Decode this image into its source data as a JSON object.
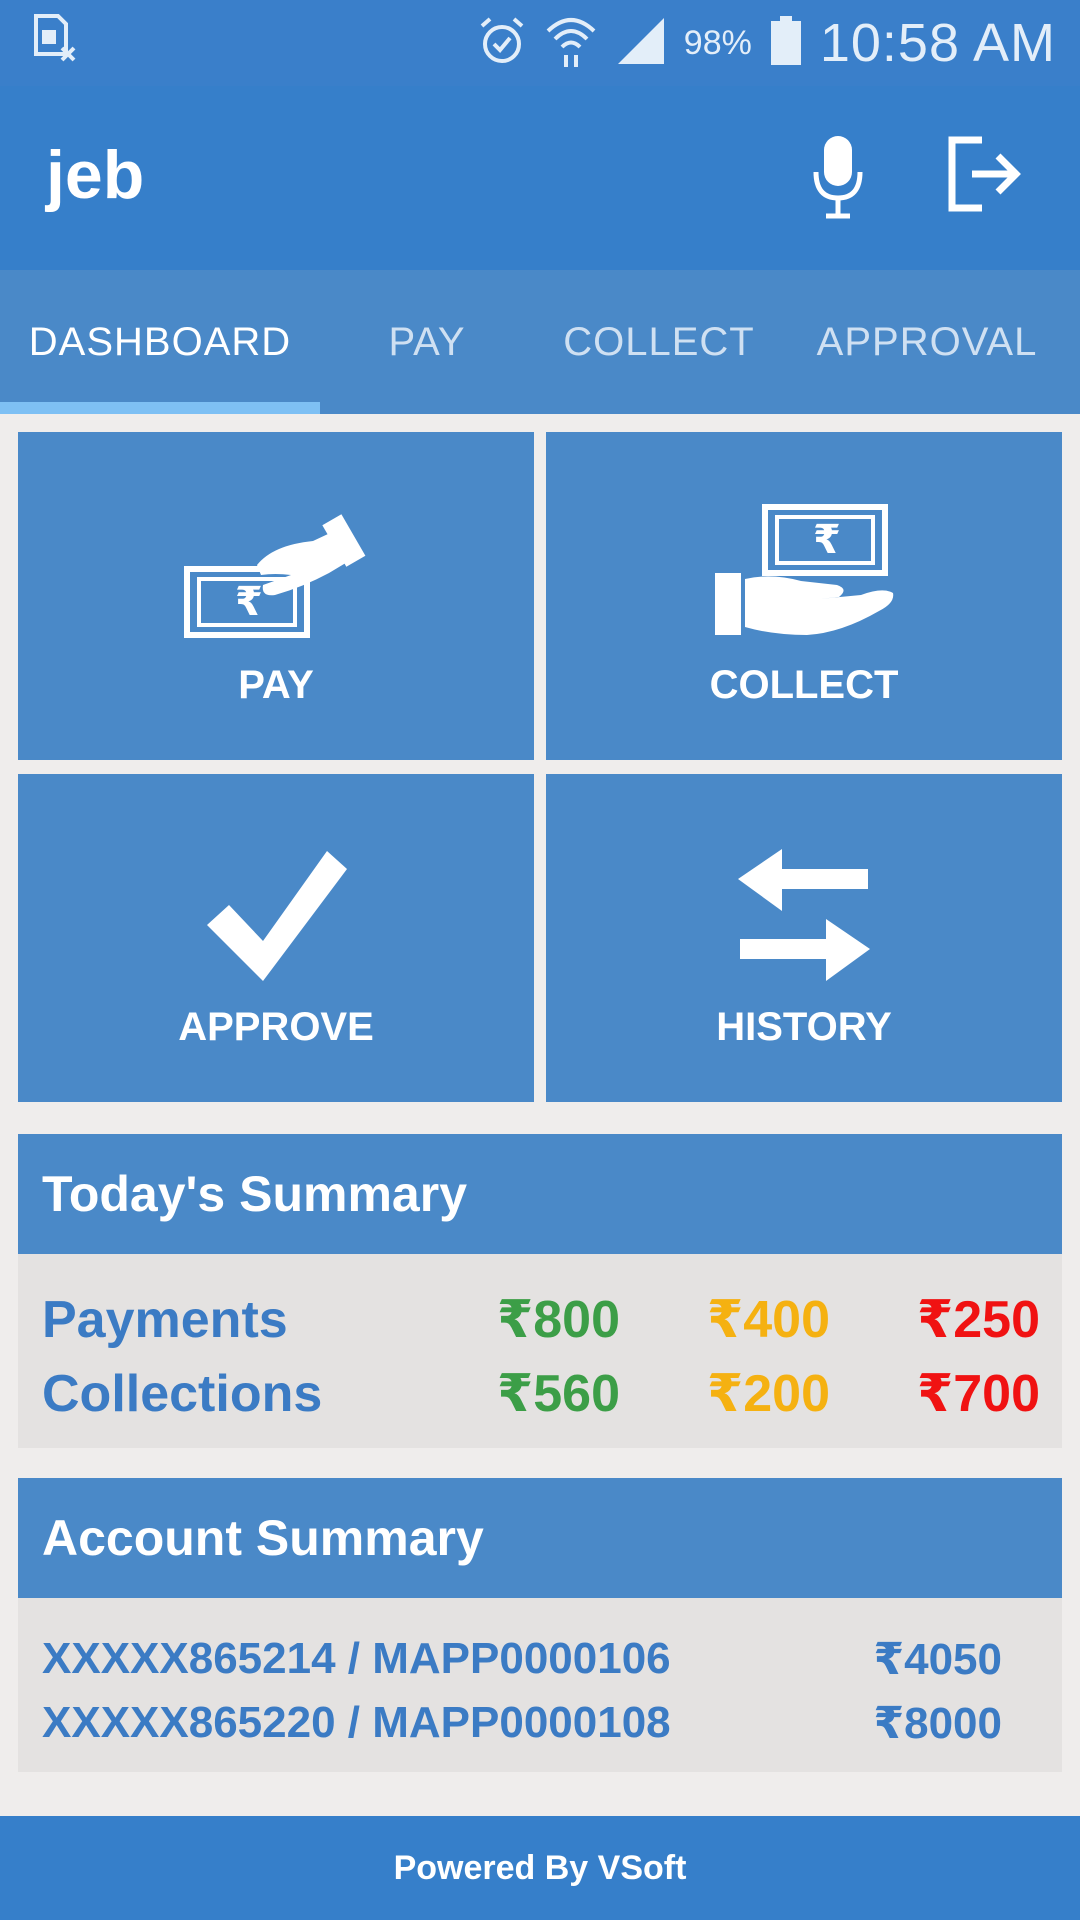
{
  "status_bar": {
    "battery": "98%",
    "time": "10:58 AM",
    "icons": [
      "sim-error-icon",
      "alarm-icon",
      "wifi-icon",
      "signal-icon",
      "battery-icon"
    ]
  },
  "app_bar": {
    "title": "jeb",
    "icons": [
      "mic-icon",
      "logout-icon"
    ]
  },
  "tabs": [
    {
      "label": "DASHBOARD",
      "active": true
    },
    {
      "label": "PAY",
      "active": false
    },
    {
      "label": "COLLECT",
      "active": false
    },
    {
      "label": "APPROVAL",
      "active": false
    }
  ],
  "tiles": [
    {
      "label": "PAY",
      "icon": "pay-money-hand-icon"
    },
    {
      "label": "COLLECT",
      "icon": "collect-money-hand-icon"
    },
    {
      "label": "APPROVE",
      "icon": "checkmark-icon"
    },
    {
      "label": "HISTORY",
      "icon": "swap-arrows-icon"
    }
  ],
  "todays_summary": {
    "title": "Today's Summary",
    "rows": [
      {
        "label": "Payments",
        "values": [
          "₹800",
          "₹400",
          "₹250"
        ]
      },
      {
        "label": "Collections",
        "values": [
          "₹560",
          "₹200",
          "₹700"
        ]
      }
    ],
    "colors": [
      "#3c9e47",
      "#f5b111",
      "#f01212"
    ]
  },
  "account_summary": {
    "title": "Account Summary",
    "rows": [
      {
        "account": "XXXXX865214 / MAPP0000106",
        "amount": "₹4050"
      },
      {
        "account": "XXXXX865220 / MAPP0000108",
        "amount": "₹8000"
      }
    ]
  },
  "footer": {
    "text": "Powered By VSoft"
  },
  "colors": {
    "primary": "#367fca",
    "tile": "#4a89c8",
    "background": "#efedec"
  }
}
